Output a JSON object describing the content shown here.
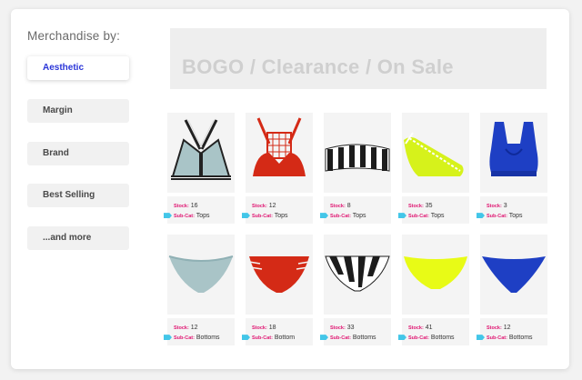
{
  "sidebar": {
    "title": "Merchandise by:",
    "items": [
      {
        "label": "Aesthetic",
        "active": true
      },
      {
        "label": "Margin",
        "active": false
      },
      {
        "label": "Brand",
        "active": false
      },
      {
        "label": "Best Selling",
        "active": false
      },
      {
        "label": "...and more",
        "active": false
      }
    ]
  },
  "banner": {
    "text": "BOGO / Clearance / On Sale"
  },
  "labels": {
    "stock": "Stock:",
    "subcat": "Sub-Cat:"
  },
  "colors": {
    "accent": "#2a35d8",
    "label_pink": "#e01672",
    "tag_cyan": "#43c6e8"
  },
  "products": {
    "tops": [
      {
        "stock": "16",
        "subcat": "Tops",
        "item": "striped-strap-triangle-bikini-top",
        "color": "#a9c4c7"
      },
      {
        "stock": "12",
        "subcat": "Tops",
        "item": "red-crochet-bikini-top",
        "color": "#d42a16"
      },
      {
        "stock": "8",
        "subcat": "Tops",
        "item": "black-white-striped-bandeau-top",
        "color": "#1c1c1c"
      },
      {
        "stock": "35",
        "subcat": "Tops",
        "item": "neon-one-shoulder-top",
        "color": "#d6f21b"
      },
      {
        "stock": "3",
        "subcat": "Tops",
        "item": "blue-racerback-bralette-top",
        "color": "#1e3fc4"
      }
    ],
    "bottoms": [
      {
        "stock": "12",
        "subcat": "Bottoms",
        "item": "light-blue-bikini-bottom",
        "color": "#a9c4c7"
      },
      {
        "stock": "18",
        "subcat": "Bottom",
        "item": "red-strappy-bikini-bottom",
        "color": "#d42a16"
      },
      {
        "stock": "33",
        "subcat": "Bottoms",
        "item": "black-white-striped-bottom",
        "color": "#1c1c1c"
      },
      {
        "stock": "41",
        "subcat": "Bottoms",
        "item": "neon-yellow-bottom",
        "color": "#e8fb16"
      },
      {
        "stock": "12",
        "subcat": "Bottoms",
        "item": "blue-thong-bottom",
        "color": "#1e3fc4"
      }
    ]
  }
}
